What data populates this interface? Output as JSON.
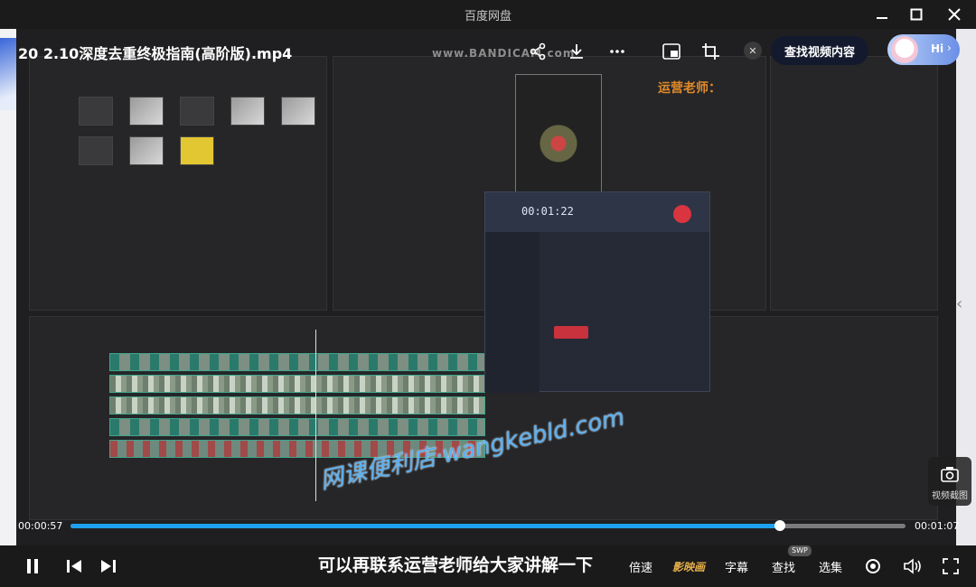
{
  "window": {
    "title": "百度网盘"
  },
  "player": {
    "video_title": "20 2.10深度去重终极指南(高阶版).mp4",
    "find_content_label": "查找视频内容",
    "assistant_label": "Hi",
    "snapshot_label": "视频截图",
    "current_time": "00:00:57",
    "total_time": "00:01:07",
    "progress_fraction": 0.85,
    "subtitle": "可以再联系运营老师给大家讲解一下",
    "controls": {
      "speed_label": "倍速",
      "yingmu_label": "影映画",
      "caption_label": "字幕",
      "search_label": "查找",
      "episodes_label": "选集",
      "swp_badge": "SWP"
    }
  },
  "video_content": {
    "bandicam_watermark": "www.BANDICAM.com",
    "teacher_label": "运营老师：",
    "overlay_watermark": "网课便利店·wangkebld.com",
    "recorder_time": "00:01:22"
  },
  "colors": {
    "accent": "#1ea0f0",
    "find_button_bg": "#141a2e",
    "record_red": "#d93540"
  }
}
